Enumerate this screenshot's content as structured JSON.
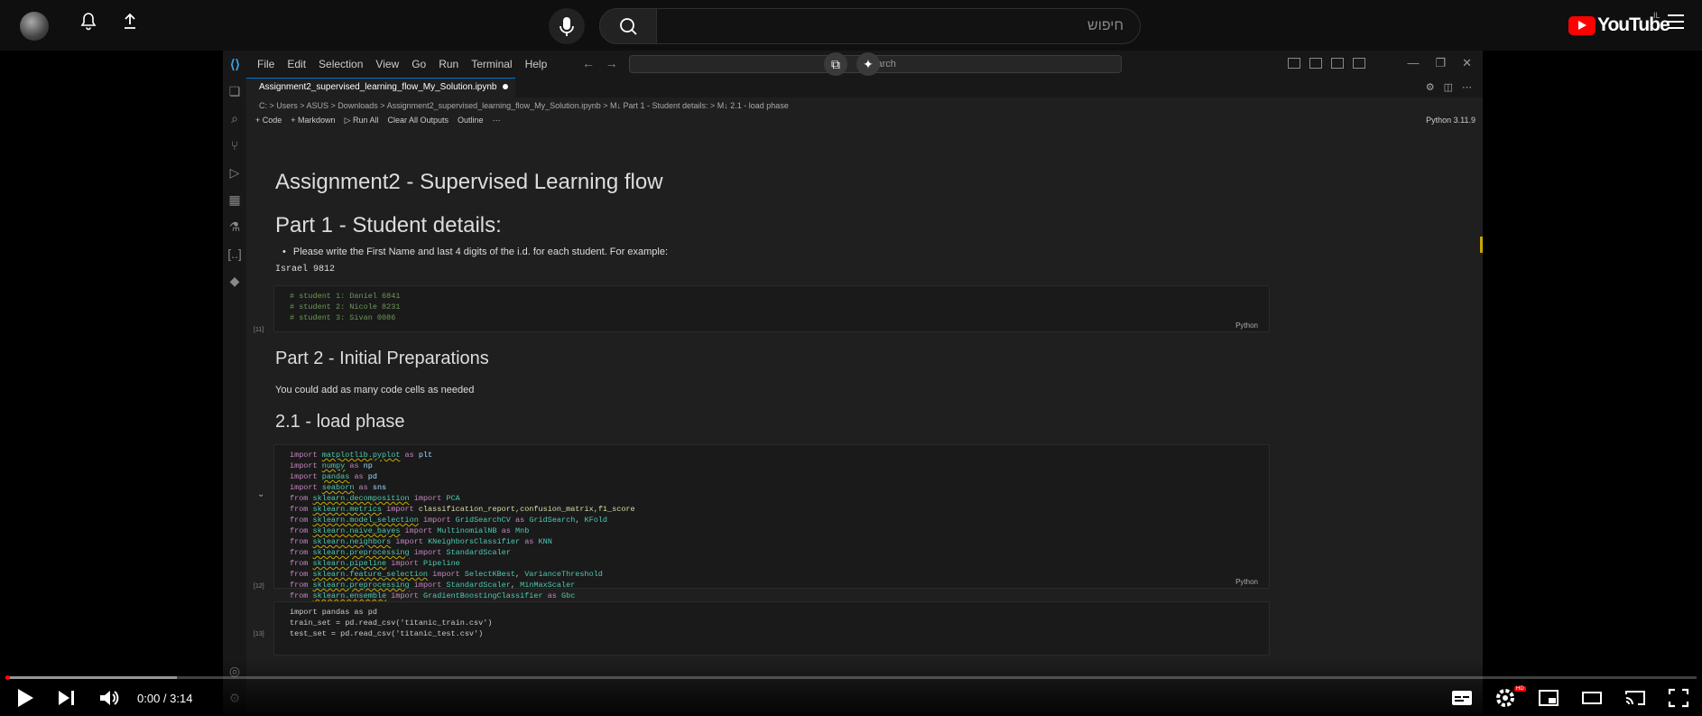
{
  "youtube": {
    "search_placeholder": "חיפוש",
    "logo_text": "YouTube",
    "country": "IL",
    "brand_color": "#ff0000"
  },
  "vscode": {
    "menu": [
      "File",
      "Edit",
      "Selection",
      "View",
      "Go",
      "Run",
      "Terminal",
      "Help"
    ],
    "search_placeholder": "Search",
    "tab_title": "Assignment2_supervised_learning_flow_My_Solution.ipynb",
    "breadcrumb": "C: > Users > ASUS > Downloads > Assignment2_supervised_learning_flow_My_Solution.ipynb > M↓ Part 1 - Student details: > M↓ 2.1 - load phase",
    "toolbar": [
      "+ Code",
      "+ Markdown",
      "▷ Run All",
      "Clear All Outputs",
      "Outline",
      "···"
    ],
    "kernel": "Python 3.11.9"
  },
  "notebook": {
    "title": "Assignment2 - Supervised Learning flow",
    "part1": "Part 1 - Student details:",
    "instruction": "Please write the First Name and last 4 digits of the i.d. for each student. For example:",
    "example": "Israel 9812",
    "cell1_exec": "[11]",
    "cell1_lines": [
      "# student 1: Daniel 6841",
      "# student 2: Nicole 8231",
      "# student 3: Sivan 0086"
    ],
    "lang_label": "Python",
    "part2": "Part 2 - Initial Preparations",
    "part2_text": "You could add as many code cells as needed",
    "section21": "2.1 - load phase",
    "cell2_exec": "[12]",
    "cell3_exec": "[13]",
    "cell3_lines": [
      "import pandas as pd",
      "train_set = pd.read_csv('titanic_train.csv')",
      "test_set = pd.read_csv('titanic_test.csv')"
    ]
  },
  "player": {
    "time": "0:00 / 3:14",
    "progress_fraction": 0.0,
    "hd_badge": "HD"
  }
}
